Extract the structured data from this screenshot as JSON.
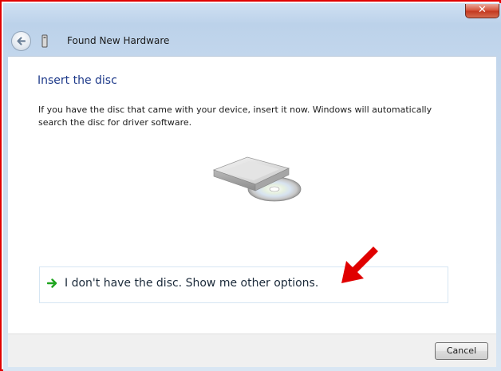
{
  "window": {
    "title": "Found New Hardware",
    "close_label": "✕",
    "accent_color": "#cfe0f2"
  },
  "icons": {
    "back": "back-arrow-icon",
    "hardware": "hardware-device-icon",
    "option_arrow": "green-arrow-icon",
    "drive": "optical-drive-icon",
    "annotation": "red-pointer-arrow-icon"
  },
  "content": {
    "heading": "Insert the disc",
    "description": "If you have the disc that came with your device, insert it now.  Windows will automatically search the disc for driver software.",
    "option_text": "I don't have the disc.  Show me other options."
  },
  "footer": {
    "cancel_label": "Cancel"
  },
  "colors": {
    "heading": "#1e3a8a",
    "option_arrow": "#1fa51f",
    "annotation": "#e00000"
  }
}
